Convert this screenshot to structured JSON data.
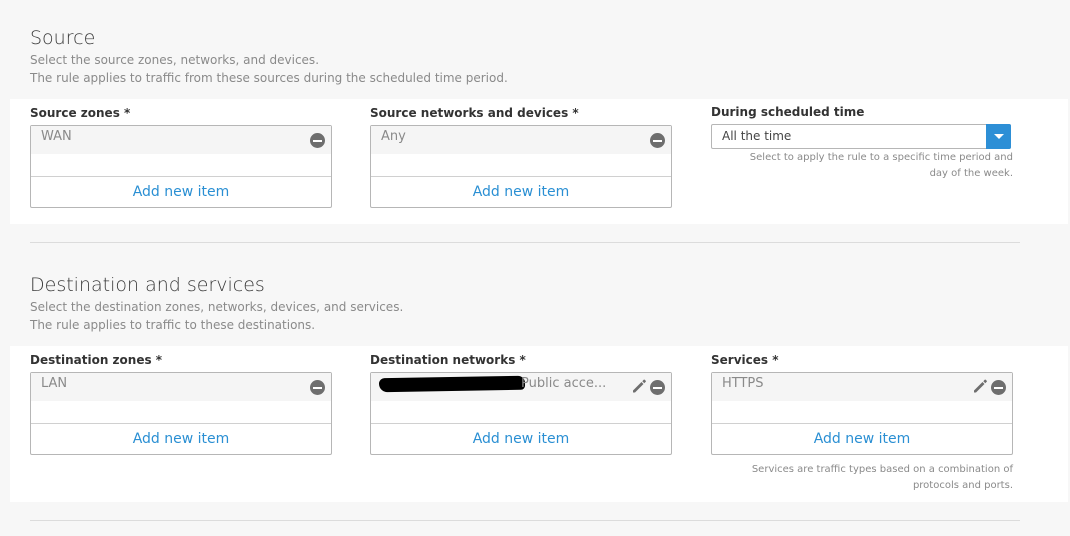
{
  "source": {
    "title": "Source",
    "desc1": "Select the source zones, networks, and devices.",
    "desc2": "The rule applies to traffic from these sources during the scheduled time period.",
    "zones": {
      "label": "Source zones *",
      "items": [
        "WAN"
      ],
      "add": "Add new item"
    },
    "networks": {
      "label": "Source networks and devices *",
      "items": [
        "Any"
      ],
      "add": "Add new item"
    },
    "schedule": {
      "label": "During scheduled time",
      "value": "All the time",
      "help1": "Select to apply the rule to a specific time period and",
      "help2": "day of the week."
    }
  },
  "destination": {
    "title": "Destination and services",
    "desc1": "Select the destination zones, networks, devices, and services.",
    "desc2": "The rule applies to traffic to these destinations.",
    "zones": {
      "label": "Destination zones *",
      "items": [
        "LAN"
      ],
      "add": "Add new item"
    },
    "networks": {
      "label": "Destination networks *",
      "items": [
        "Public acce..."
      ],
      "add": "Add new item"
    },
    "services": {
      "label": "Services *",
      "items": [
        "HTTPS"
      ],
      "add": "Add new item",
      "help1": "Services are traffic types based on a combination of",
      "help2": "protocols and ports."
    }
  },
  "icons": {
    "remove": "minus-circle-icon",
    "edit": "pencil-icon",
    "dropdown": "chevron-down-icon"
  },
  "colors": {
    "link": "#2a8fd3",
    "dropdown_button": "#2d8fd6",
    "panel": "#ffffff",
    "page": "#f7f7f7"
  }
}
